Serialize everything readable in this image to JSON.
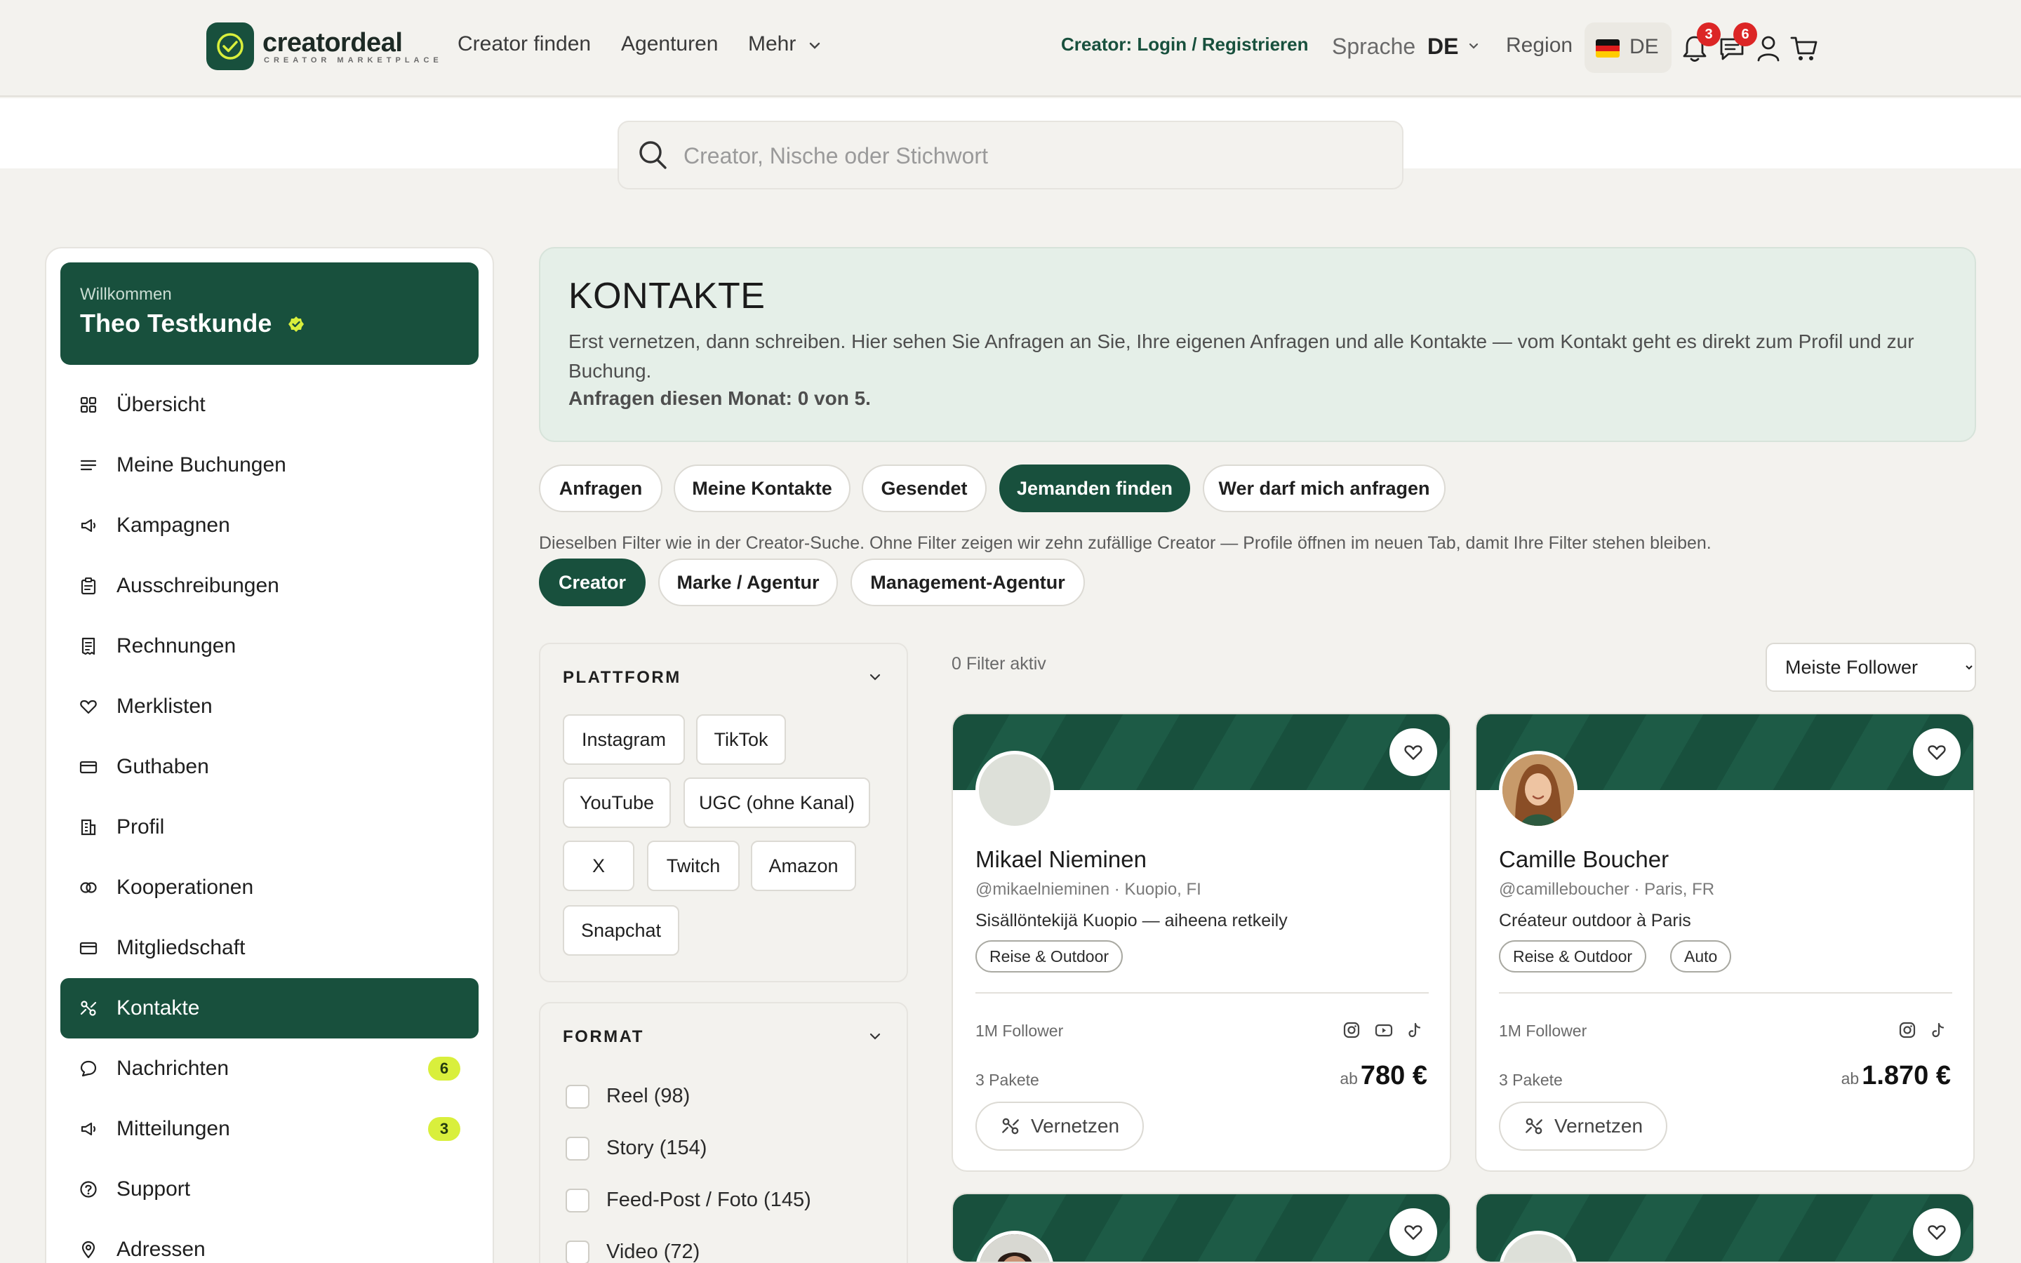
{
  "brand": {
    "name": "creatordeal",
    "tagline": "CREATOR MARKETPLACE",
    "accent": "#18503d"
  },
  "nav": {
    "links": [
      "Creator finden",
      "Agenturen",
      "Mehr"
    ],
    "creator_login": "Creator: Login / Registrieren",
    "language_label": "Sprache",
    "language_value": "DE",
    "region_label": "Region",
    "region_code": "DE",
    "notifications_count": "3",
    "messages_count": "6"
  },
  "search": {
    "placeholder": "Creator, Nische oder Stichwort"
  },
  "sidebar": {
    "welcome": "Willkommen",
    "user_name": "Theo Testkunde",
    "items": [
      {
        "label": "Übersicht",
        "icon": "grid-icon"
      },
      {
        "label": "Meine Buchungen",
        "icon": "list-icon"
      },
      {
        "label": "Kampagnen",
        "icon": "megaphone-icon"
      },
      {
        "label": "Ausschreibungen",
        "icon": "clipboard-icon"
      },
      {
        "label": "Rechnungen",
        "icon": "receipt-icon"
      },
      {
        "label": "Merklisten",
        "icon": "heart-icon"
      },
      {
        "label": "Guthaben",
        "icon": "card-icon"
      },
      {
        "label": "Profil",
        "icon": "building-icon"
      },
      {
        "label": "Kooperationen",
        "icon": "rings-icon"
      },
      {
        "label": "Mitgliedschaft",
        "icon": "card-icon"
      },
      {
        "label": "Kontakte",
        "icon": "connect-icon",
        "active": true
      },
      {
        "label": "Nachrichten",
        "icon": "chat-icon",
        "count": "6"
      },
      {
        "label": "Mitteilungen",
        "icon": "megaphone-icon",
        "count": "3"
      },
      {
        "label": "Support",
        "icon": "help-icon"
      },
      {
        "label": "Adressen",
        "icon": "pin-icon"
      }
    ]
  },
  "main": {
    "title": "KONTAKTE",
    "description": "Erst vernetzen, dann schreiben. Hier sehen Sie Anfragen an Sie, Ihre eigenen Anfragen und alle Kontakte — vom Kontakt geht es direkt zum Profil und zur Buchung.",
    "quota": "Anfragen diesen Monat: 0 von 5.",
    "tabs": [
      "Anfragen",
      "Meine Kontakte",
      "Gesendet",
      "Jemanden finden",
      "Wer darf mich anfragen"
    ],
    "active_tab": "Jemanden finden",
    "filter_hint": "Dieselben Filter wie in der Creator-Suche. Ohne Filter zeigen wir zehn zufällige Creator — Profile öffnen im neuen Tab, damit Ihre Filter stehen bleiben.",
    "type_tabs": [
      "Creator",
      "Marke / Agentur",
      "Management-Agentur"
    ],
    "active_type": "Creator"
  },
  "filters": {
    "platform": {
      "title": "PLATTFORM",
      "options": [
        "Instagram",
        "TikTok",
        "YouTube",
        "UGC (ohne Kanal)",
        "X",
        "Twitch",
        "Amazon",
        "Snapchat"
      ]
    },
    "format": {
      "title": "FORMAT",
      "options": [
        "Reel (98)",
        "Story (154)",
        "Feed-Post / Foto (145)",
        "Video (72)"
      ]
    }
  },
  "results": {
    "active_filters": "0 Filter aktiv",
    "sort_options": [
      "Meiste Follower"
    ],
    "sort_value": "Meiste Follower",
    "connect_label": "Vernetzen",
    "cards": [
      {
        "name": "Mikael Nieminen",
        "handle": "@mikaelnieminen · Kuopio, FI",
        "bio": "Sisällöntekijä Kuopio — aiheena retkeily",
        "tags": [
          "Reise & Outdoor"
        ],
        "followers": "1M Follower",
        "platforms": [
          "instagram-icon",
          "youtube-icon",
          "tiktok-icon"
        ],
        "packages": "3 Pakete",
        "price_prefix": "ab",
        "price": "780 €"
      },
      {
        "name": "Camille Boucher",
        "handle": "@camilleboucher · Paris, FR",
        "bio": "Créateur outdoor à Paris",
        "tags": [
          "Reise & Outdoor",
          "Auto"
        ],
        "followers": "1M Follower",
        "platforms": [
          "instagram-icon",
          "tiktok-icon"
        ],
        "packages": "3 Pakete",
        "price_prefix": "ab",
        "price": "1.870 €"
      }
    ]
  }
}
